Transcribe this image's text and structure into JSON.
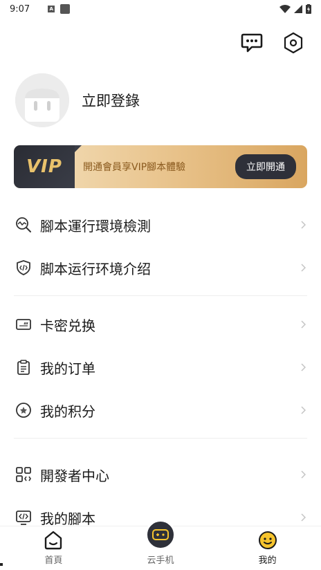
{
  "status_bar": {
    "time": "9:07",
    "notif_letter": "A"
  },
  "header": {
    "chat_icon": "chat-icon",
    "settings_icon": "hexagon-settings-icon"
  },
  "profile": {
    "login_label": "立即登錄"
  },
  "vip": {
    "logo": "VIP",
    "description": "開通會員享VIP腳本體驗",
    "button": "立即開通",
    "accent": "#e9c26c"
  },
  "menu_group_1": [
    {
      "label": "腳本運行環境檢測",
      "icon": "environment-check-icon"
    },
    {
      "label": "脚本运行环境介绍",
      "icon": "shield-code-icon"
    }
  ],
  "menu_group_2": [
    {
      "label": "卡密兑换",
      "icon": "card-icon"
    },
    {
      "label": "我的订单",
      "icon": "clipboard-icon"
    },
    {
      "label": "我的积分",
      "icon": "points-icon"
    }
  ],
  "menu_group_3": [
    {
      "label": "開發者中心",
      "icon": "grid-icon"
    },
    {
      "label": "我的腳本",
      "icon": "code-screen-icon"
    }
  ],
  "bottom_nav": {
    "home": "首頁",
    "cloud_phone": "云手机",
    "mine": "我的"
  }
}
